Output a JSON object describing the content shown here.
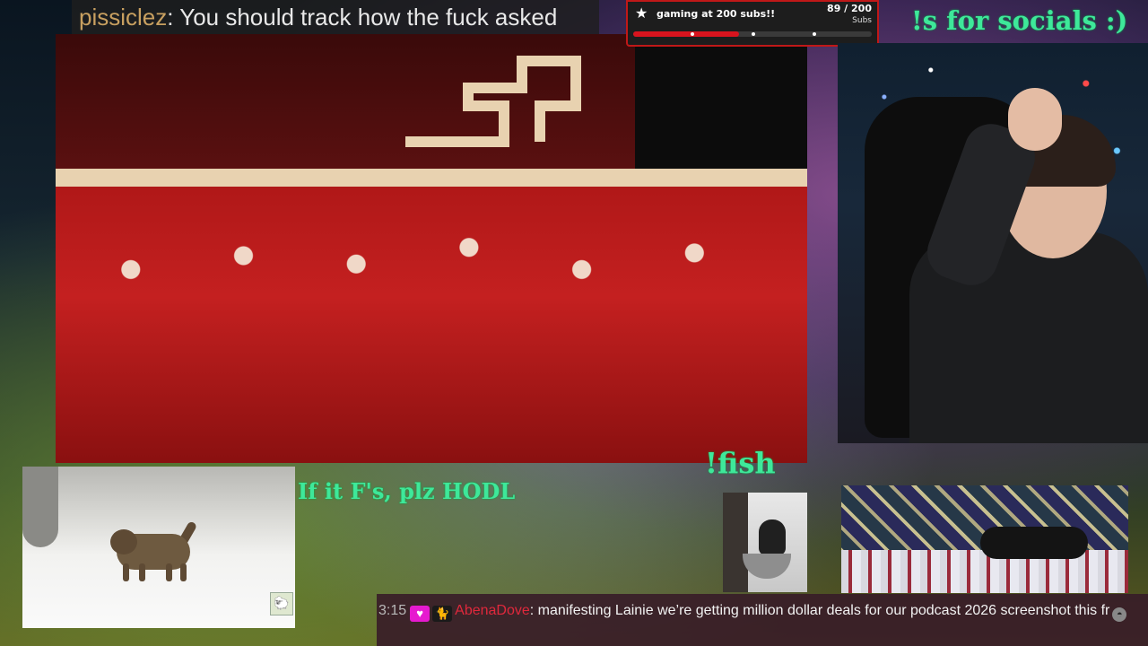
{
  "top_chat": {
    "username": "pissiclez",
    "message": "You should track how the fuck asked"
  },
  "goal": {
    "title": "gaming at 200 subs!!",
    "count": "89 / 200",
    "unit": "Subs",
    "progress": 0.445,
    "star_icon": "★",
    "fill_color": "#d8141e"
  },
  "overlays": {
    "socials": "!s for socials :)",
    "fish": "!fish",
    "hodl": "If it F's, plz HODL"
  },
  "bottom_chat": {
    "time": "3:15",
    "badge_icon": "♥",
    "badge2_icon": "🐈",
    "username": "AbenaDove",
    "message": "manifesting Lainie we’re getting million dollar deals for our podcast 2026 screenshot this fr",
    "emote_icon": "◓"
  },
  "colors": {
    "accent_green": "#3ee89a",
    "username_red": "#e0283c",
    "goal_border": "#c01818"
  }
}
